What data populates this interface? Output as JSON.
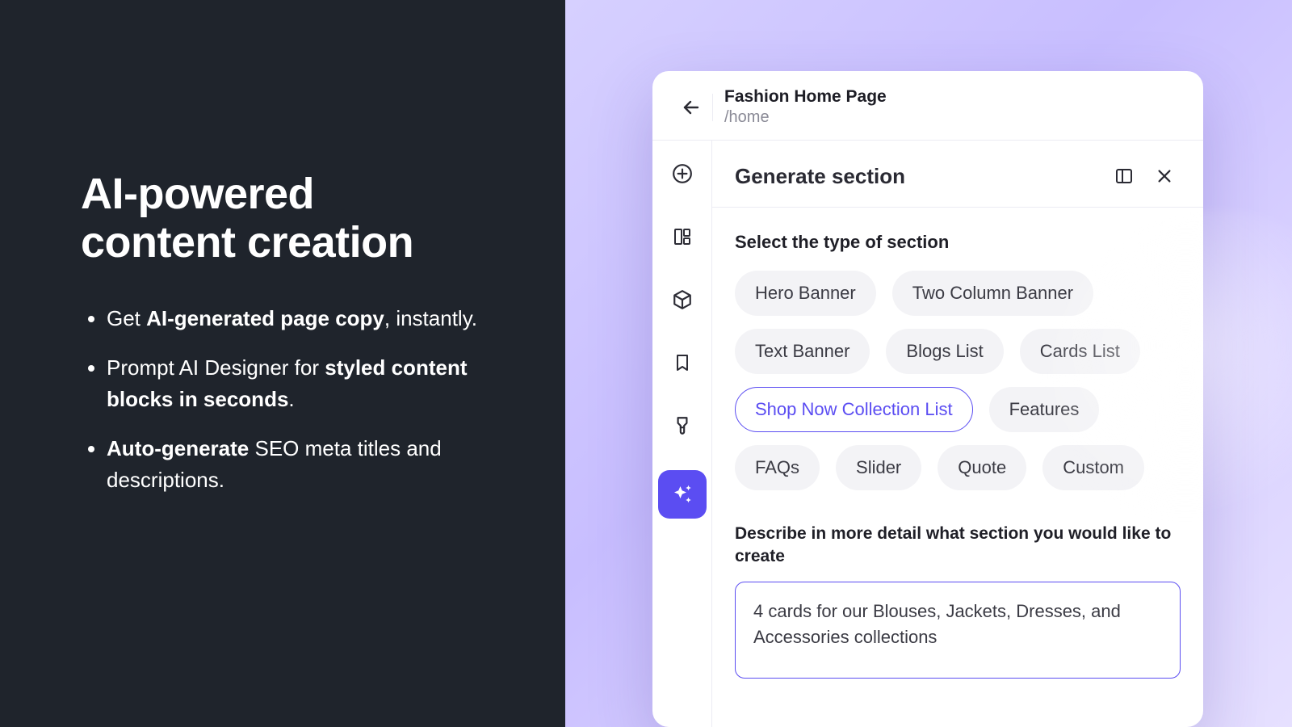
{
  "marketing": {
    "headline_l1": "AI-powered",
    "headline_l2": "content creation",
    "bullets": [
      {
        "pre": "Get ",
        "bold": "AI-generated page copy",
        "post": ", instantly."
      },
      {
        "pre": "Prompt AI Designer for ",
        "bold": "styled content blocks in seconds",
        "post": "."
      },
      {
        "pre": "",
        "bold": "Auto-generate",
        "post": " SEO meta titles and descriptions."
      }
    ]
  },
  "app": {
    "page_title": "Fashion Home Page",
    "page_path": "/home",
    "rail": [
      {
        "name": "add-icon"
      },
      {
        "name": "layout-icon"
      },
      {
        "name": "cube-icon"
      },
      {
        "name": "bookmark-icon"
      },
      {
        "name": "brush-icon"
      },
      {
        "name": "sparkles-icon",
        "active": true
      }
    ],
    "panel": {
      "title": "Generate section",
      "section_label": "Select the type of section",
      "chips": [
        "Hero Banner",
        "Two Column Banner",
        "Text Banner",
        "Blogs List",
        "Cards List",
        "Shop Now Collection List",
        "Features",
        "FAQs",
        "Slider",
        "Quote",
        "Custom"
      ],
      "selected_chip": "Shop Now Collection List",
      "describe_label": "Describe in more detail what section you would like to create",
      "prompt_value": "4 cards for our Blouses, Jackets, Dresses, and Accessories collections"
    }
  }
}
